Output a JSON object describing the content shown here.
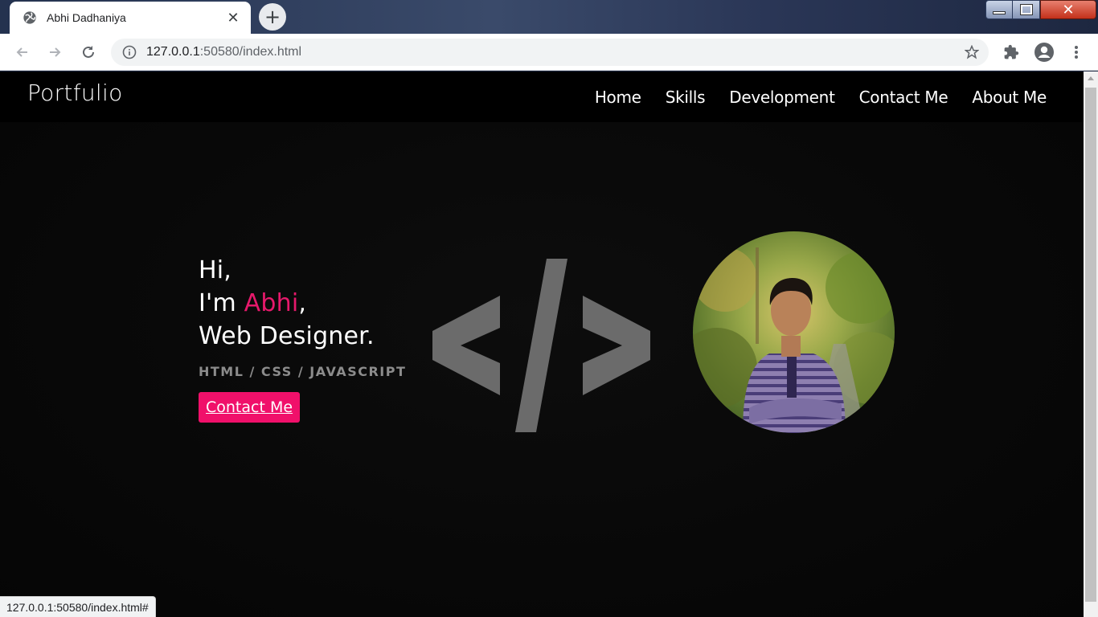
{
  "browser": {
    "tab_title": "Abhi Dadhaniya",
    "new_tab_symbol": "+",
    "close_symbol": "✕",
    "url_host": "127.0.0.1",
    "url_rest": ":50580/index.html",
    "status_url": "127.0.0.1:50580/index.html#",
    "window_buttons": {
      "close": "✕"
    }
  },
  "site": {
    "brand": "Portfulio",
    "nav": [
      "Home",
      "Skills",
      "Development",
      "Contact Me",
      "About Me"
    ],
    "hero": {
      "greeting": "Hi,",
      "intro_prefix": "I'm ",
      "name": "Abhi",
      "intro_suffix": ",",
      "role": "Web Designer.",
      "stack": "HTML / CSS / JAVASCRIPT",
      "cta": "Contact Me"
    }
  },
  "colors": {
    "accent": "#e6196b",
    "button": "#f0106a",
    "code_icon": "#6b6b6b"
  }
}
